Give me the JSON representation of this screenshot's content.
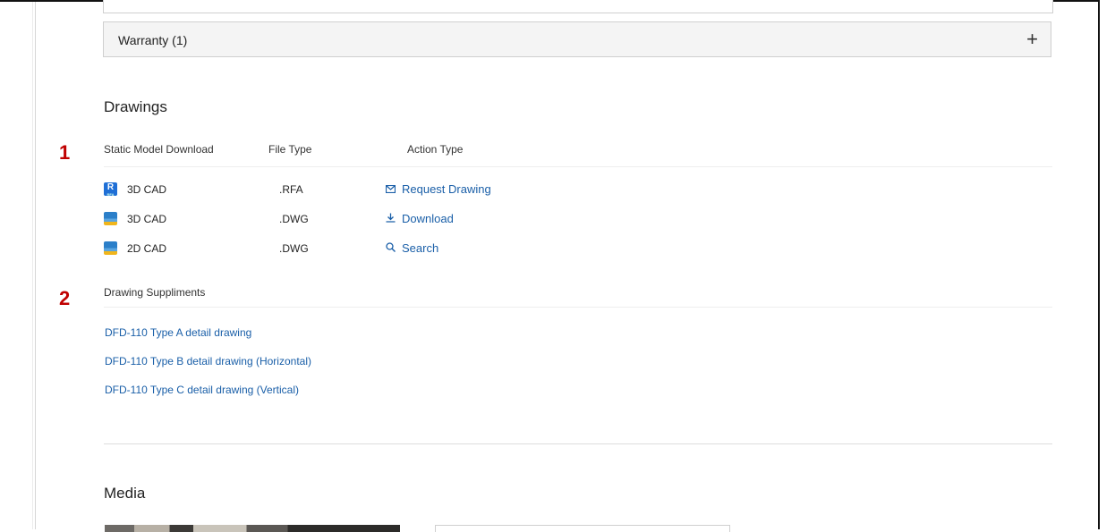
{
  "warranty_accordion": {
    "label": "Warranty (1)",
    "toggle_symbol": "+"
  },
  "drawings": {
    "title": "Drawings",
    "marker_1": "1",
    "columns": {
      "model": "Static Model Download",
      "file_type": "File Type",
      "action": "Action Type"
    },
    "rows": [
      {
        "icon": "revit-file-icon",
        "name": "3D CAD",
        "file_type": ".RFA",
        "action": "Request Drawing",
        "action_icon": "envelope-icon"
      },
      {
        "icon": "dwg-file-icon",
        "name": "3D CAD",
        "file_type": ".DWG",
        "action": "Download",
        "action_icon": "download-icon"
      },
      {
        "icon": "dwg-file-icon",
        "name": "2D CAD",
        "file_type": ".DWG",
        "action": "Search",
        "action_icon": "search-icon"
      }
    ],
    "marker_2": "2",
    "supplements_heading": "Drawing Suppliments",
    "supplements": [
      "DFD-110 Type A detail drawing",
      "DFD-110 Type B detail drawing (Horizontal)",
      "DFD-110 Type C detail drawing (Vertical)"
    ]
  },
  "media": {
    "title": "Media"
  },
  "colors": {
    "link": "#1a5fa8",
    "marker": "#c00000",
    "revit_blue": "#1f6fd6"
  }
}
